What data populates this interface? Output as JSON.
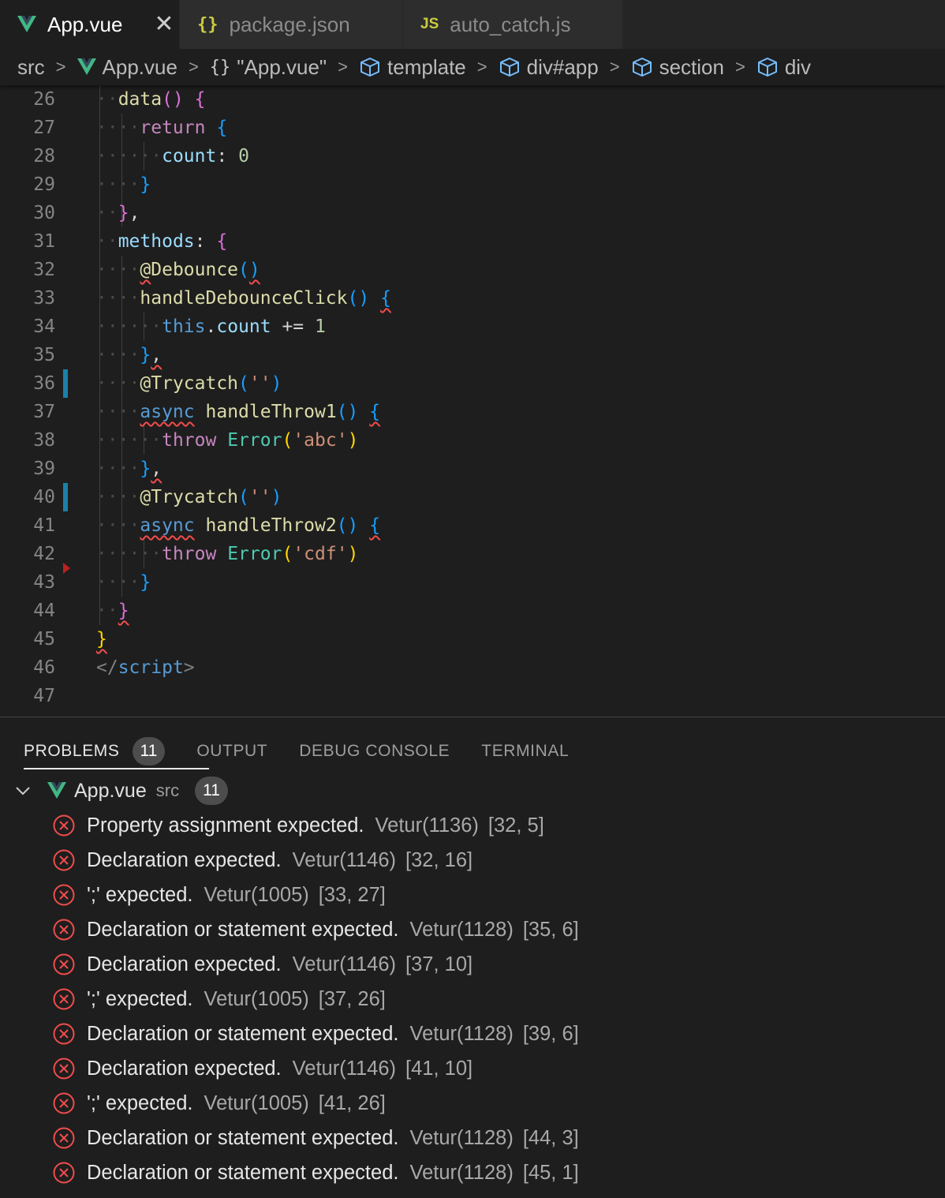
{
  "tabs": [
    {
      "label": "App.vue",
      "icon": "vue-icon",
      "active": true,
      "closable": true
    },
    {
      "label": "package.json",
      "icon": "json-icon",
      "glyph": "{}",
      "active": false
    },
    {
      "label": "auto_catch.js",
      "icon": "js-icon",
      "glyph": "JS",
      "active": false
    }
  ],
  "breadcrumb": [
    {
      "label": "src",
      "icon": ""
    },
    {
      "label": "App.vue",
      "icon": "vue-icon"
    },
    {
      "label": "\"App.vue\"",
      "icon": "braces-icon",
      "glyph": "{}"
    },
    {
      "label": "template",
      "icon": "cube-icon"
    },
    {
      "label": "div#app",
      "icon": "cube-icon"
    },
    {
      "label": "section",
      "icon": "cube-icon"
    },
    {
      "label": "div",
      "icon": "cube-icon"
    }
  ],
  "editor": {
    "line_numbers": [
      "26",
      "27",
      "28",
      "29",
      "30",
      "31",
      "32",
      "33",
      "34",
      "35",
      "36",
      "37",
      "38",
      "39",
      "40",
      "41",
      "42",
      "43",
      "44",
      "45",
      "46",
      "47"
    ],
    "tokens": {
      "data": "data",
      "paren_pair": "()",
      "brace_open": "{",
      "brace_close": "}",
      "return": "return",
      "count": "count",
      "colon": ":",
      "zero": "0",
      "comma": ",",
      "methods": "methods",
      "at": "@",
      "debounce": "Debounce",
      "handle_debounce": "handleDebounceClick",
      "this": "this",
      "dot": ".",
      "plus_eq": "+=",
      "one": "1",
      "trycatch": "Trycatch",
      "paren_open": "(",
      "paren_close": ")",
      "empty_str": "''",
      "async": "async",
      "handle_throw1": "handleThrow1",
      "handle_throw2": "handleThrow2",
      "throw": "throw",
      "error": "Error",
      "str_abc": "'abc'",
      "str_cdf": "'cdf'",
      "close_tag_open": "</",
      "script": "script",
      "tag_close": ">"
    }
  },
  "panel": {
    "tabs": [
      {
        "label": "PROBLEMS",
        "badge": "11",
        "active": true
      },
      {
        "label": "OUTPUT"
      },
      {
        "label": "DEBUG CONSOLE"
      },
      {
        "label": "TERMINAL"
      }
    ],
    "file": {
      "name": "App.vue",
      "dir": "src",
      "count": "11"
    },
    "problems": [
      {
        "message": "Property assignment expected.",
        "source": "Vetur(1136)",
        "position": "[32, 5]"
      },
      {
        "message": "Declaration expected.",
        "source": "Vetur(1146)",
        "position": "[32, 16]"
      },
      {
        "message": "';' expected.",
        "source": "Vetur(1005)",
        "position": "[33, 27]"
      },
      {
        "message": "Declaration or statement expected.",
        "source": "Vetur(1128)",
        "position": "[35, 6]"
      },
      {
        "message": "Declaration expected.",
        "source": "Vetur(1146)",
        "position": "[37, 10]"
      },
      {
        "message": "';' expected.",
        "source": "Vetur(1005)",
        "position": "[37, 26]"
      },
      {
        "message": "Declaration or statement expected.",
        "source": "Vetur(1128)",
        "position": "[39, 6]"
      },
      {
        "message": "Declaration expected.",
        "source": "Vetur(1146)",
        "position": "[41, 10]"
      },
      {
        "message": "';' expected.",
        "source": "Vetur(1005)",
        "position": "[41, 26]"
      },
      {
        "message": "Declaration or statement expected.",
        "source": "Vetur(1128)",
        "position": "[44, 3]"
      },
      {
        "message": "Declaration or statement expected.",
        "source": "Vetur(1128)",
        "position": "[45, 1]"
      }
    ]
  },
  "colors": {
    "error": "#f14c4c",
    "vue_green": "#42b883",
    "modified_gutter": "#1b81a8"
  }
}
